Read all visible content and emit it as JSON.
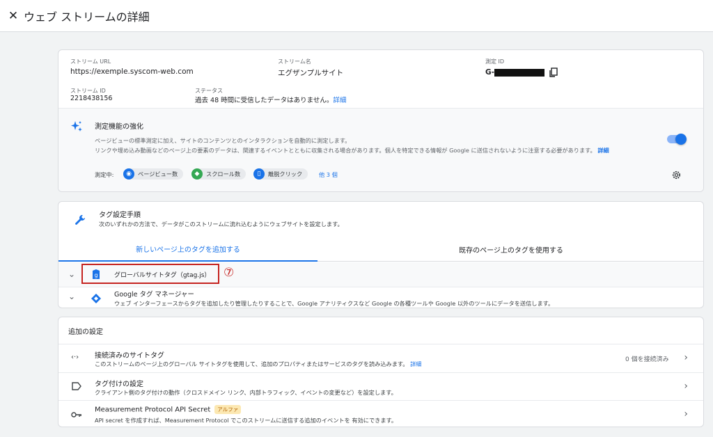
{
  "header": {
    "title": "ウェブ ストリームの詳細",
    "close_label": "✕"
  },
  "stream": {
    "url_label": "ストリーム URL",
    "url": "https://exemple.syscom-web.com",
    "name_label": "ストリーム名",
    "name": "エグザンプルサイト",
    "mid_label": "測定 ID",
    "mid_prefix": "G-",
    "id_label": "ストリーム ID",
    "id": "2218438156",
    "status_label": "ステータス",
    "status": "過去 48 時間に受信したデータはありません。",
    "status_link": "詳細"
  },
  "enhanced": {
    "title": "測定機能の強化",
    "desc1": "ページビューの標準測定に加え、サイトのコンテンツとのインタラクションを自動的に測定します。",
    "desc2": "リンクや埋め込み動画などのページ上の要素のデータは、関連するイベントとともに収集される場合があります。個人を特定できる情報が Google に送信されないように注意する必要があります。",
    "desc2_link": "詳細",
    "measuring_label": "測定中:",
    "chips": [
      "ページビュー数",
      "スクロール数",
      "離脱クリック"
    ],
    "more": "他 3 個"
  },
  "tag": {
    "title": "タグ設定手順",
    "subtitle": "次のいずれかの方法で、データがこのストリームに流れ込むようにウェブサイトを設定します。",
    "tab_new": "新しいページ上のタグを追加する",
    "tab_existing": "既存のページ上のタグを使用する",
    "gtag_label": "グローバルサイトタグ（gtag.js）",
    "annotation": "⑦",
    "gtm_title": "Google タグ マネージャー",
    "gtm_desc": "ウェブ インターフェースからタグを追加したり管理したりすることで、Google アナリティクスなど Google の各種ツールや Google 以外のツールにデータを送信します。"
  },
  "additional": {
    "title": "追加の設定",
    "items": [
      {
        "title": "接続済みのサイトタグ",
        "desc": "このストリームのページ上のグローバル サイトタグを使用して、追加のプロパティまたはサービスのタグを読み込みます。",
        "link": "詳細",
        "right": "0 個を接続済み"
      },
      {
        "title": "タグ付けの設定",
        "desc": "クライアント側のタグ付けの動作（クロスドメイン リンク、内部トラフィック、イベントの変更など）を設定します。"
      },
      {
        "title": "Measurement Protocol API Secret",
        "badge": "アルファ",
        "desc": "API secret を作成すれば、Measurement Protocol でこのストリームに送信する追加のイベントを 有効にできます。"
      }
    ]
  },
  "colors": {
    "accent": "#1a73e8",
    "annotation_red": "#c5221f"
  }
}
